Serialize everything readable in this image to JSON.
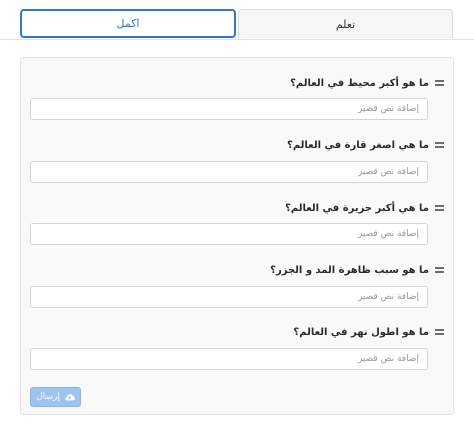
{
  "tabs": {
    "learn": "تعلم",
    "complete": "اكمل"
  },
  "questions": [
    {
      "text": "ما هو أكبر محيط في العالم؟",
      "placeholder": "إضافة نص قصير",
      "value": ""
    },
    {
      "text": "ما هي اصغر قارة في العالم؟",
      "placeholder": "إضافة نص قصير",
      "value": ""
    },
    {
      "text": "ما هي أكبر جزيرة في العالم؟",
      "placeholder": "إضافة نص قصير",
      "value": ""
    },
    {
      "text": "ما هو سبب ظاهرة المد و الجزر؟",
      "placeholder": "إضافة نص قصير",
      "value": ""
    },
    {
      "text": "ما هو اطول نهر في العالم؟",
      "placeholder": "إضافة نص قصير",
      "value": ""
    }
  ],
  "submit": {
    "label": "إرسال",
    "icon": "cloud-upload-icon"
  },
  "colors": {
    "accent": "#2e78d2",
    "submit_bg": "#9cc4ee",
    "card_bg": "#f9f9f9"
  }
}
